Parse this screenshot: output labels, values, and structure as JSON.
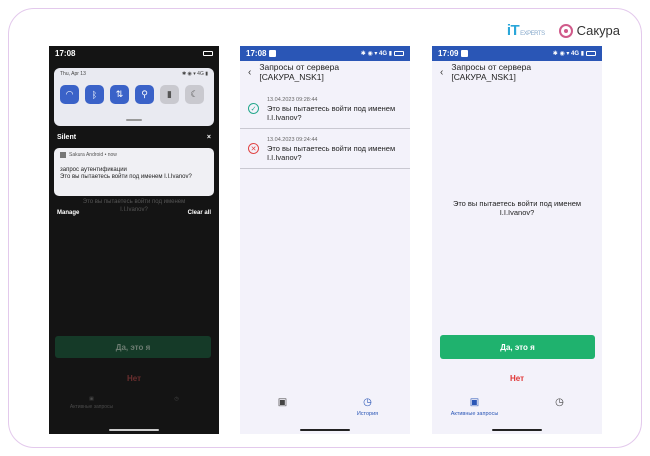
{
  "branding": {
    "it_logo": "iT",
    "it_sub": "EXPERTS",
    "sakura": "Сакура"
  },
  "phone1": {
    "time": "17:08",
    "date": "Thu, Apr 13",
    "silent_label": "Silent",
    "close": "×",
    "notif_app": "Sakura Android • now",
    "notif_title": "запрос аутентификации",
    "notif_text": "Это вы пытаетесь войти под именем I.I.Ivanov?",
    "manage": "Manage",
    "clear_all": "Clear all",
    "bg_line1": "Это вы пытаетесь войти под именем",
    "bg_line2": "I.I.Ivanov?",
    "yes": "Да, это я",
    "no": "Нет",
    "tab_active": "Активные запросы"
  },
  "phone2": {
    "time": "17:08",
    "title": "Запросы от сервера [САКУРА_NSK1]",
    "requests": [
      {
        "status": "approved",
        "timestamp": "13.04.2023 09:28:44",
        "line1": "Это вы пытаетесь войти под именем",
        "line2": "I.I.Ivanov?"
      },
      {
        "status": "rejected",
        "timestamp": "13.04.2023 09:24:44",
        "line1": "Это вы пытаетесь войти под именем",
        "line2": "I.I.Ivanov?"
      }
    ],
    "tab_history": "История"
  },
  "phone3": {
    "time": "17:09",
    "title": "Запросы от сервера [САКУРА_NSK1]",
    "question_line1": "Это вы пытаетесь войти под именем",
    "question_line2": "I.I.Ivanov?",
    "yes": "Да, это я",
    "no": "Нет",
    "tab_active": "Активные запросы"
  },
  "colors": {
    "accent_blue": "#2a56b6",
    "green": "#1fb26e",
    "red": "#e03535"
  }
}
